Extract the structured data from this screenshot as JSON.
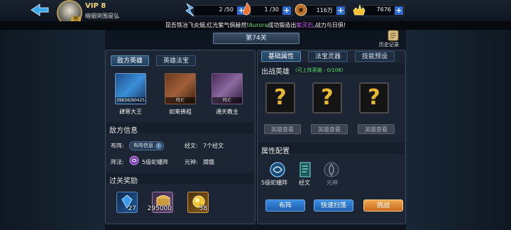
{
  "header": {
    "vip_label": "VIP 8",
    "player_name": "暗烟突围是弘",
    "avatar_badge": "壹",
    "resources": [
      {
        "icon": "stamina-icon",
        "value": "2 /50",
        "color": "#4aa0f0"
      },
      {
        "icon": "energy-icon",
        "value": "1 /30",
        "color": "#f07030"
      },
      {
        "icon": "copper-coin-icon",
        "value": "116万",
        "color": "#d08a3a"
      },
      {
        "icon": "gold-ingot-icon",
        "value": "7676",
        "color": "#f5c02a"
      }
    ]
  },
  "marquee": {
    "prefix": "昆吾铁冶飞炎烟,红光紫气俱赫然!",
    "player": "Aurora",
    "middle": "成功锻造出",
    "item": "紫灵石",
    "suffix": ",战力与日俱!"
  },
  "stage_title": "第74关",
  "history_label": "历史记录",
  "left": {
    "tabs": [
      {
        "label": "敌方英雄",
        "active": true
      },
      {
        "label": "英雄法宝",
        "active": false
      }
    ],
    "heroes": [
      {
        "name": "肆寒大王",
        "tag": "39656/90425",
        "color": "#3a8fd8"
      },
      {
        "name": "如来佛祖",
        "tag": "阵亡",
        "color": "#a0603a"
      },
      {
        "name": "通天教主",
        "tag": "阵亡",
        "color": "#8a6aa0"
      }
    ],
    "enemy_info_title": "敌方信息",
    "formation_label": "布阵:",
    "formation_chip": "布阵信息",
    "scripture_label": "经文:",
    "scripture_value": "7个经文",
    "array_label": "阵法:",
    "array_value": "5级蛇蟠阵",
    "spirit_label": "元神:",
    "spirit_value": "嫦娥",
    "reward_title": "过关奖励",
    "rewards": [
      {
        "icon": "blue-gem-icon",
        "value": "27"
      },
      {
        "icon": "treasure-chest-icon",
        "value": "295000"
      },
      {
        "icon": "gold-orb-icon",
        "value": "38"
      }
    ]
  },
  "right": {
    "tabs": [
      {
        "label": "基础属性",
        "active": true
      },
      {
        "label": "法宝灵器",
        "active": false
      },
      {
        "label": "技能预设",
        "active": false
      }
    ],
    "deploy_title": "出战英雄",
    "deploy_hint": "(可上阵英雄 : 0/108)",
    "slot_glyph": "?",
    "view_button": "英雄查看",
    "attr_title": "属性配置",
    "attrs": [
      {
        "label": "5级蛇蟠阵",
        "icon": "swirl-array-icon",
        "active": true
      },
      {
        "label": "经文",
        "icon": "scroll-icon",
        "active": true
      },
      {
        "label": "元神",
        "icon": "spirit-icon",
        "active": false
      }
    ],
    "buttons": [
      {
        "label": "布阵",
        "style": "blue"
      },
      {
        "label": "快速扫荡",
        "style": "blue"
      },
      {
        "label": "挑战",
        "style": "orange"
      }
    ]
  }
}
